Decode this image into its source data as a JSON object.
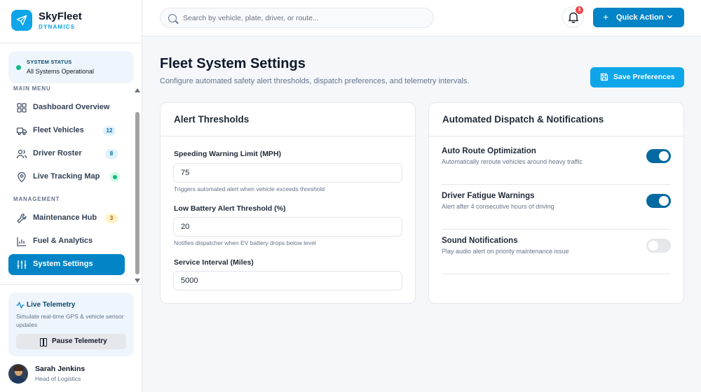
{
  "brand": {
    "name": "SkyFleet",
    "sub": "DYNAMICS"
  },
  "status": {
    "label": "SYSTEM STATUS",
    "value": "All Systems Operational"
  },
  "nav": {
    "main_label": "MAIN MENU",
    "main_items": [
      {
        "label": "Dashboard Overview",
        "icon": "grid-icon"
      },
      {
        "label": "Fleet Vehicles",
        "badge": "12",
        "icon": "truck-icon"
      },
      {
        "label": "Driver Roster",
        "badge": "8",
        "icon": "users-icon"
      },
      {
        "label": "Live Tracking Map",
        "icon": "map-pin-icon"
      }
    ],
    "management_label": "MANAGEMENT",
    "management_items": [
      {
        "label": "Maintenance Hub",
        "badge": "3",
        "icon": "wrench-icon"
      },
      {
        "label": "Fuel & Analytics",
        "icon": "bar-chart-icon"
      },
      {
        "label": "System Settings",
        "icon": "sliders-icon",
        "active": true
      }
    ]
  },
  "telemetry": {
    "title": "Live Telemetry",
    "description": "Simulate real-time GPS & vehicle sensor updates",
    "button": "Pause Telemetry"
  },
  "user": {
    "name": "Sarah Jenkins",
    "role": "Head of Logistics"
  },
  "header": {
    "search_placeholder": "Search by vehicle, plate, driver, or route...",
    "notification_count": "3",
    "quick_action": "Quick Action"
  },
  "page": {
    "title": "Fleet System Settings",
    "subtitle": "Configure automated safety alert thresholds, dispatch preferences, and telemetry intervals.",
    "save_button": "Save Preferences"
  },
  "alerts": {
    "title": "Alert Thresholds",
    "fields": [
      {
        "label": "Speeding Warning Limit (MPH)",
        "value": "75",
        "hint": "Triggers automated alert when vehicle exceeds threshold"
      },
      {
        "label": "Low Battery Alert Threshold (%)",
        "value": "20",
        "hint": "Notifies dispatcher when EV battery drops below level"
      },
      {
        "label": "Service Interval (Miles)",
        "value": "5000"
      }
    ]
  },
  "dispatch": {
    "title": "Automated Dispatch & Notifications",
    "toggles": [
      {
        "title": "Auto Route Optimization",
        "desc": "Automatically reroute vehicles around heavy traffic",
        "on": true
      },
      {
        "title": "Driver Fatigue Warnings",
        "desc": "Alert after 4 consecutive hours of driving",
        "on": true
      },
      {
        "title": "Sound Notifications",
        "desc": "Play audio alert on priority maintenance issue",
        "on": false
      }
    ]
  },
  "colors": {
    "accent": "#0284c7",
    "brand": "#0ea5e9",
    "success": "#10b981",
    "danger": "#ef4444"
  }
}
